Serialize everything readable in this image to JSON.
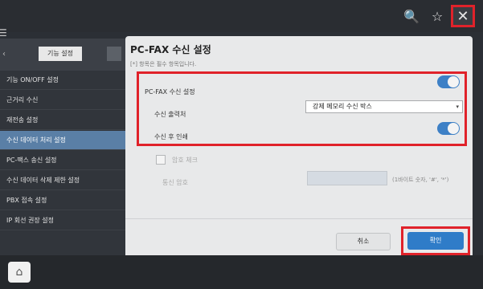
{
  "topbar": {
    "search_icon": "🔍",
    "star_icon": "☆",
    "close_icon": "✕"
  },
  "sidebar": {
    "title": "기능 설정",
    "items": [
      {
        "label": "기능 ON/OFF 설정"
      },
      {
        "label": "근거리 수신"
      },
      {
        "label": "재전송 설정"
      },
      {
        "label": "수신 데이터 처리 설정"
      },
      {
        "label": "PC-팩스 송신 설정"
      },
      {
        "label": "수신 데이터 삭제 제한 설정"
      },
      {
        "label": "PBX 접속 설정"
      },
      {
        "label": "IP 회선 권장 설정"
      }
    ]
  },
  "panel": {
    "title": "PC-FAX 수신 설정",
    "note": "[*] 항목은 필수 항목입니다.",
    "receive_setting_label": "PC-FAX 수신 설정",
    "receive_setting_on": true,
    "destination_label": "수신 출력처",
    "destination_value": "강제 메모리 수신 박스",
    "print_after_label": "수신 후 인쇄",
    "print_after_on": true,
    "password_check_label": "암호 체크",
    "password_label": "통신 암호",
    "password_hint": "(1바이트 숫자, '#', '*')",
    "cancel_label": "취소",
    "ok_label": "확인"
  },
  "bottombar": {
    "home_icon": "⌂"
  }
}
